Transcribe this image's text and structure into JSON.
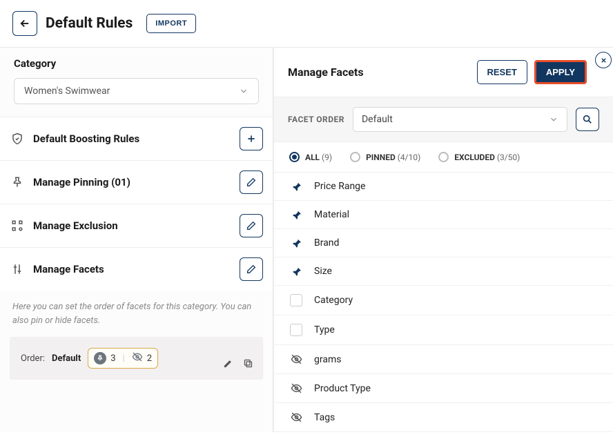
{
  "header": {
    "title": "Default Rules",
    "import_label": "IMPORT"
  },
  "left": {
    "category_label": "Category",
    "category_value": "Women's Swimwear",
    "rules": [
      {
        "label": "Default Boosting Rules",
        "button": "plus",
        "icon": "shield"
      },
      {
        "label": "Manage Pinning (01)",
        "button": "edit",
        "icon": "pin"
      },
      {
        "label": "Manage Exclusion",
        "button": "edit",
        "icon": "grid"
      },
      {
        "label": "Manage Facets",
        "button": "edit",
        "icon": "filter"
      }
    ],
    "helper": "Here you can set the order of facets for this category. You can also pin or hide facets.",
    "order_label": "Order:",
    "order_value": "Default",
    "pinned_count": "3",
    "hidden_count": "2"
  },
  "right": {
    "title": "Manage Facets",
    "reset_label": "RESET",
    "apply_label": "APPLY",
    "facet_order_label": "FACET ORDER",
    "facet_order_value": "Default",
    "tabs": {
      "all": {
        "label": "ALL",
        "count": "(9)"
      },
      "pinned": {
        "label": "PINNED",
        "count": "(4/10)"
      },
      "excluded": {
        "label": "EXCLUDED",
        "count": "(3/50)"
      }
    },
    "facets": [
      {
        "name": "Price Range",
        "state": "pinned"
      },
      {
        "name": "Material",
        "state": "pinned"
      },
      {
        "name": "Brand",
        "state": "pinned"
      },
      {
        "name": "Size",
        "state": "pinned"
      },
      {
        "name": "Category",
        "state": "unchecked"
      },
      {
        "name": "Type",
        "state": "unchecked"
      },
      {
        "name": "grams",
        "state": "hidden"
      },
      {
        "name": "Product Type",
        "state": "hidden"
      },
      {
        "name": "Tags",
        "state": "hidden"
      }
    ]
  }
}
